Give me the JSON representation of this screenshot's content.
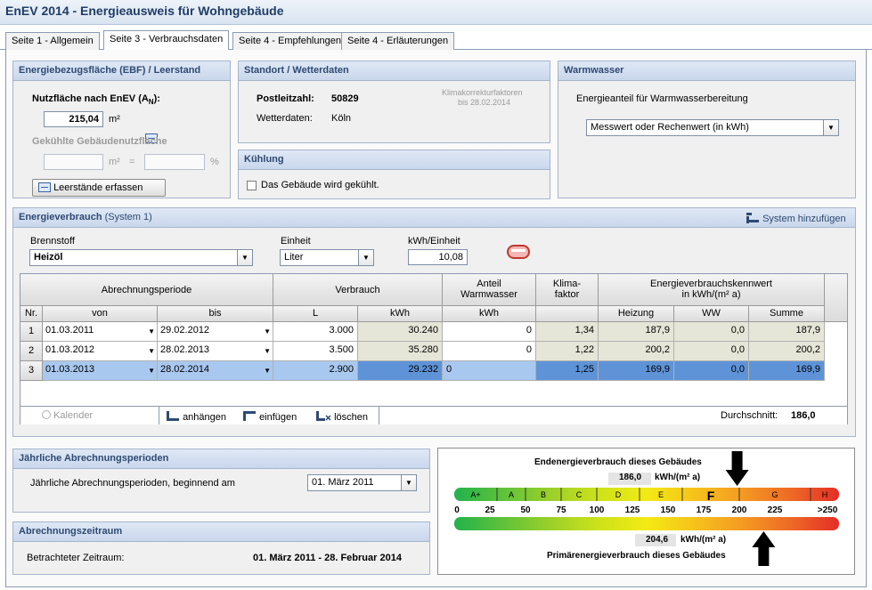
{
  "app": {
    "title": "EnEV 2014 - Energieausweis für Wohngebäude"
  },
  "tabs": [
    "Seite 1  -  Allgemein",
    "Seite 3  -  Verbrauchsdaten",
    "Seite 4 - Empfehlungen",
    "Seite 4 - Erläuterungen"
  ],
  "ebf": {
    "header": "Energiebezugsfläche (EBF) / Leerstand",
    "nutz_label": "Nutzfläche nach EnEV (A",
    "nutz_sub": "N",
    "nutz_suffix": "):",
    "nutz_value": "215,04",
    "unit_m2": "m²",
    "gekuehlt_label": "Gekühlte Gebäudenutzfläche",
    "eq": "=",
    "pct": "%",
    "leerstand_button": "Leerstände erfassen"
  },
  "standort": {
    "header": "Standort / Wetterdaten",
    "plz_label": "Postleitzahl:",
    "plz_value": "50829",
    "wetter_label": "Wetterdaten:",
    "wetter_value": "Köln",
    "klima_line1": "Klimakorrekturfaktoren",
    "klima_line2": "bis 28.02.2014"
  },
  "kuehlung": {
    "header": "Kühlung",
    "checkbox_label": "Das Gebäude wird gekühlt."
  },
  "warmwasser": {
    "header": "Warmwasser",
    "label": "Energieanteil für Warmwasserbereitung",
    "select_value": "Messwert oder Rechenwert (in kWh)"
  },
  "verbrauch": {
    "header": "Energieverbrauch",
    "header_sub": "(System 1)",
    "add_system": "System hinzufügen",
    "brennstoff_label": "Brennstoff",
    "brennstoff_value": "Heizöl",
    "einheit_label": "Einheit",
    "einheit_value": "Liter",
    "kwh_einheit_label": "kWh/Einheit",
    "kwh_einheit_value": "10,08",
    "grid": {
      "h_period": "Abrechnungsperiode",
      "h_verbrauch": "Verbrauch",
      "h_anteil1": "Anteil",
      "h_anteil2": "Warmwasser",
      "h_klima1": "Klima-",
      "h_klima2": "faktor",
      "h_kenn1": "Energieverbrauchskennwert",
      "h_kenn2": "in kWh/(m² a)",
      "h_nr": "Nr.",
      "h_von": "von",
      "h_bis": "bis",
      "h_l": "L",
      "h_kwh": "kWh",
      "h_kwh2": "kWh",
      "h_heizung": "Heizung",
      "h_ww": "WW",
      "h_summe": "Summe",
      "rows": [
        {
          "nr": "1",
          "von": "01.03.2011",
          "bis": "29.02.2012",
          "l": "3.000",
          "kwh": "30.240",
          "ww_kwh": "0",
          "klima": "1,34",
          "heizung": "187,9",
          "ww": "0,0",
          "summe": "187,9"
        },
        {
          "nr": "2",
          "von": "01.03.2012",
          "bis": "28.02.2013",
          "l": "3.500",
          "kwh": "35.280",
          "ww_kwh": "0",
          "klima": "1,22",
          "heizung": "200,2",
          "ww": "0,0",
          "summe": "200,2"
        },
        {
          "nr": "3",
          "von": "01.03.2013",
          "bis": "28.02.2014",
          "l": "2.900",
          "kwh": "29.232",
          "ww_kwh": "0",
          "klima": "1,25",
          "heizung": "169,9",
          "ww": "0,0",
          "summe": "169,9"
        }
      ],
      "kalender": "Kalender",
      "anhaengen": "anhängen",
      "einfuegen": "einfügen",
      "loeschen": "löschen",
      "durchschnitt_label": "Durchschnitt:",
      "durchschnitt_value": "186,0"
    }
  },
  "jaehrlich": {
    "header": "Jährliche Abrechnungsperioden",
    "label": "Jährliche Abrechnungsperioden, beginnend am",
    "value": "01. März 2011"
  },
  "zeitraum": {
    "header": "Abrechnungszeitraum",
    "label": "Betrachteter Zeitraum:",
    "value": "01. März 2011 - 28. Februar 2014"
  },
  "scale": {
    "end_label": "Endenergieverbrauch dieses Gebäudes",
    "end_value": "186,0",
    "end_unit": "kWh/(m² a)",
    "prim_label": "Primärenergieverbrauch dieses Gebäudes",
    "prim_value": "204,6",
    "prim_unit": "kWh/(m² a)",
    "classes": [
      "A+",
      "A",
      "B",
      "C",
      "D",
      "E",
      "F",
      "G",
      "H"
    ],
    "ticks": [
      "0",
      "25",
      "50",
      "75",
      "100",
      "125",
      "150",
      "175",
      "200",
      "225",
      ">250"
    ],
    "end_numeric": 186.0,
    "prim_numeric": 204.6
  }
}
